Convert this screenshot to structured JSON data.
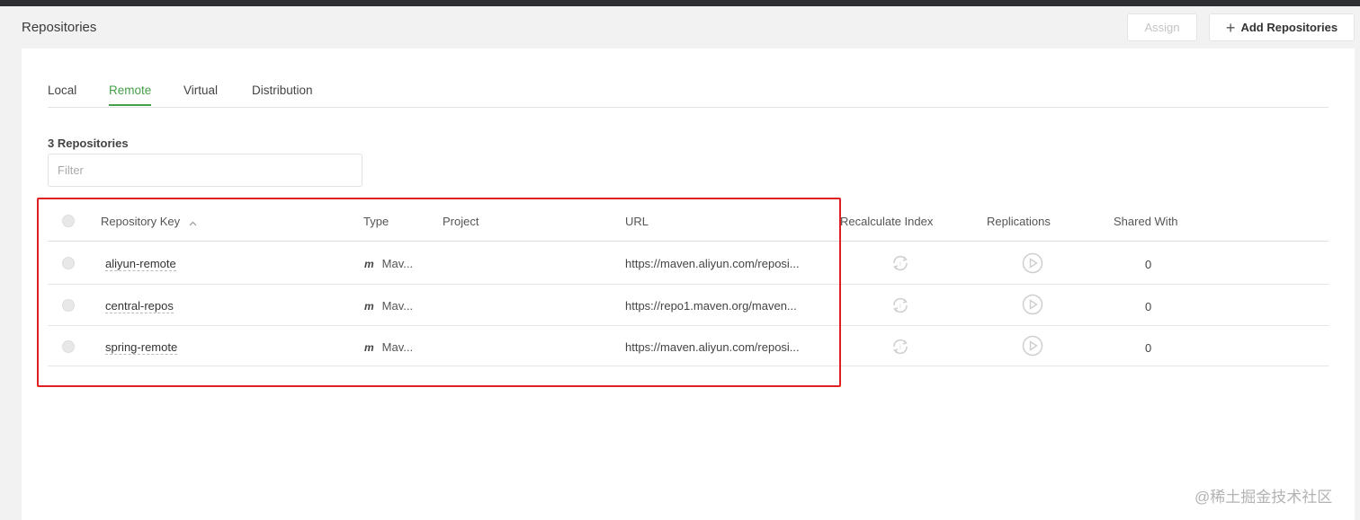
{
  "page": {
    "title": "Repositories",
    "assign_label": "Assign",
    "add_label": "Add Repositories"
  },
  "tabs": [
    {
      "label": "Local"
    },
    {
      "label": "Remote",
      "active": true
    },
    {
      "label": "Virtual"
    },
    {
      "label": "Distribution"
    }
  ],
  "repo_count": "3 Repositories",
  "filter": {
    "placeholder": "Filter",
    "value": ""
  },
  "columns": {
    "key": "Repository Key",
    "type": "Type",
    "project": "Project",
    "url": "URL",
    "recalc": "Recalculate Index",
    "replications": "Replications",
    "shared": "Shared With"
  },
  "sort": {
    "column": "Repository Key",
    "direction": "ascending"
  },
  "rows": [
    {
      "key": "aliyun-remote",
      "type_icon": "m",
      "type": "Mav...",
      "project": "",
      "url": "https://maven.aliyun.com/reposi...",
      "shared": "0"
    },
    {
      "key": "central-repos",
      "type_icon": "m",
      "type": "Mav...",
      "project": "",
      "url": "https://repo1.maven.org/maven...",
      "shared": "0"
    },
    {
      "key": "spring-remote",
      "type_icon": "m",
      "type": "Mav...",
      "project": "",
      "url": "https://maven.aliyun.com/reposi...",
      "shared": "0"
    }
  ],
  "watermark": "@稀土掘金技术社区",
  "colors": {
    "accent": "#43a047",
    "highlight": "#e02020",
    "topbar": "#2d2f33"
  }
}
